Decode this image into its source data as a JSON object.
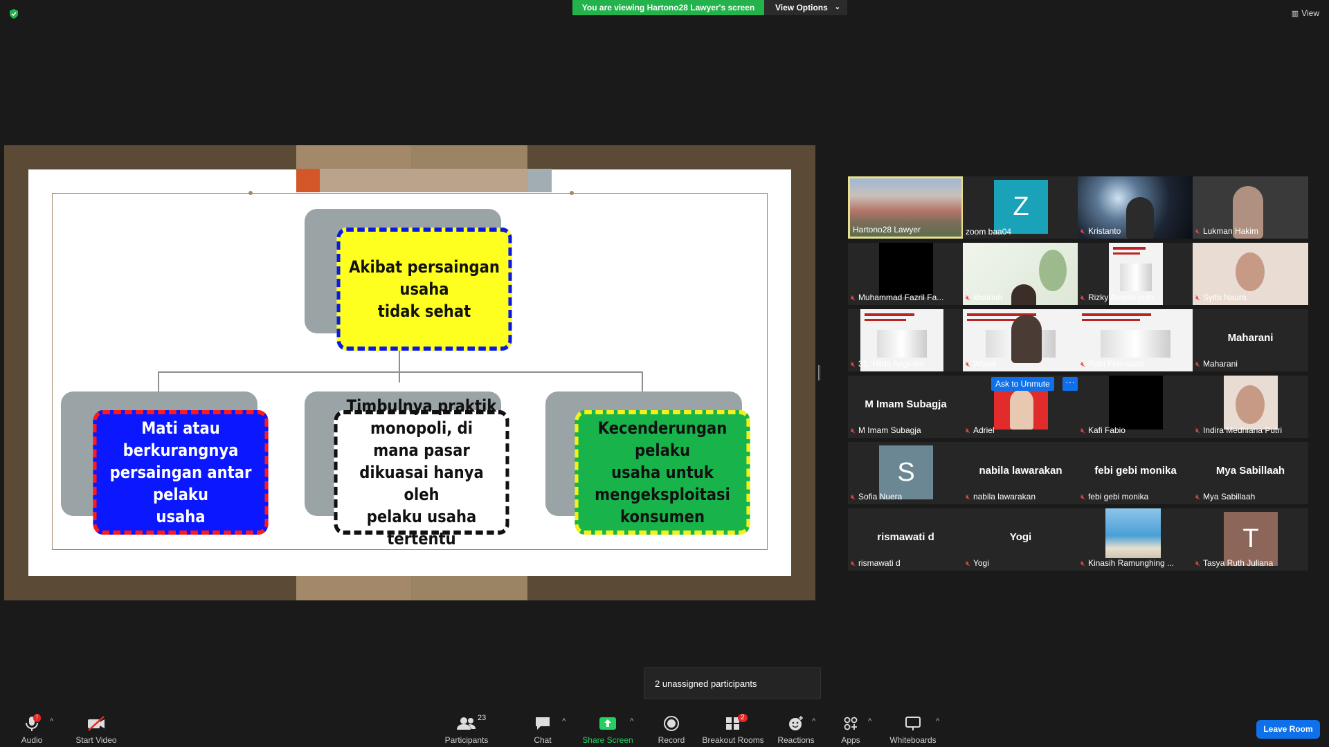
{
  "top_bar": {
    "viewing_banner": "You are viewing Hartono28 Lawyer's screen",
    "view_options_label": "View Options",
    "view_label": "View"
  },
  "slide": {
    "root": [
      "Akibat persaingan usaha",
      "tidak sehat"
    ],
    "left": [
      "Mati atau berkurangnya",
      "persaingan antar pelaku",
      "usaha"
    ],
    "middle": [
      "Timbulnya praktik",
      "monopoli, di mana pasar",
      "dikuasai hanya oleh",
      "pelaku usaha tertentu"
    ],
    "right": [
      "Kecenderungan pelaku",
      "usaha untuk",
      "mengeksploitasi",
      "konsumen"
    ],
    "colors": {
      "root_fill": "#ffff1f",
      "root_border": "#0b1ae0",
      "left_fill": "#0a17ff",
      "left_border": "#ff1a1a",
      "right_fill": "#18b34a",
      "right_border": "#f4f01a"
    }
  },
  "participants": [
    {
      "name": "Hartono28 Lawyer",
      "muted": false,
      "kind": "video-landscape",
      "active": true
    },
    {
      "name": "zoom baa04",
      "muted": false,
      "kind": "letter",
      "letter": "Z",
      "color": "#1aa2b8"
    },
    {
      "name": "Kristanto",
      "muted": true,
      "kind": "video-cave"
    },
    {
      "name": "Lukman Hakim",
      "muted": true,
      "kind": "video-person"
    },
    {
      "name": "Muhammad Fazril Fa...",
      "muted": true,
      "kind": "black"
    },
    {
      "name": "khairiah",
      "muted": true,
      "kind": "video-wall"
    },
    {
      "name": "Rizky Amelia putri",
      "muted": true,
      "kind": "video-slide-narrow"
    },
    {
      "name": "Syifa Naura",
      "muted": true,
      "kind": "video-face"
    },
    {
      "name": "31. Hilda Angraini",
      "muted": true,
      "kind": "video-slide"
    },
    {
      "name": "Wandi",
      "muted": true,
      "kind": "video-slide-person"
    },
    {
      "name": "Putri Febriyanti",
      "muted": true,
      "kind": "video-slide"
    },
    {
      "name": "Maharani",
      "muted": true,
      "kind": "name",
      "big": "Maharani"
    },
    {
      "name": "M Imam Subagja",
      "muted": true,
      "kind": "name",
      "big": "M Imam Subagja"
    },
    {
      "name": "Adriel",
      "muted": true,
      "kind": "video-red",
      "ask_unmute": "Ask to Unmute",
      "more": "···"
    },
    {
      "name": "Kafi Fabio",
      "muted": true,
      "kind": "black"
    },
    {
      "name": "Indira Medhiana Putri",
      "muted": true,
      "kind": "video-selfie"
    },
    {
      "name": "Sofia Nuera",
      "muted": true,
      "kind": "letter",
      "letter": "S",
      "color": "#6b8793"
    },
    {
      "name": "nabila lawarakan",
      "muted": true,
      "kind": "name",
      "big": "nabila lawarakan"
    },
    {
      "name": "febi gebi monika",
      "muted": true,
      "kind": "name",
      "big": "febi gebi monika"
    },
    {
      "name": "Mya Sabillaah",
      "muted": true,
      "kind": "name",
      "big": "Mya Sabillaah"
    },
    {
      "name": "rismawati d",
      "muted": true,
      "kind": "name",
      "big": "rismawati d"
    },
    {
      "name": "Yogi",
      "muted": true,
      "kind": "name",
      "big": "Yogi"
    },
    {
      "name": "Kinasih Ramunghing ...",
      "muted": true,
      "kind": "video-beach"
    },
    {
      "name": "Tasya Ruth Juliana",
      "muted": true,
      "kind": "letter",
      "letter": "T",
      "color": "#8c6759"
    }
  ],
  "popup": {
    "unassigned": "2 unassigned participants"
  },
  "toolbar": {
    "audio": "Audio",
    "audio_badge": "!",
    "start_video": "Start Video",
    "participants": "Participants",
    "participants_count": "23",
    "chat": "Chat",
    "share_screen": "Share Screen",
    "record": "Record",
    "breakout_rooms": "Breakout Rooms",
    "breakout_badge": "2",
    "reactions": "Reactions",
    "apps": "Apps",
    "whiteboards": "Whiteboards",
    "leave_room": "Leave Room",
    "accent_share": "#23d160",
    "accent_leave": "#0e71eb"
  }
}
